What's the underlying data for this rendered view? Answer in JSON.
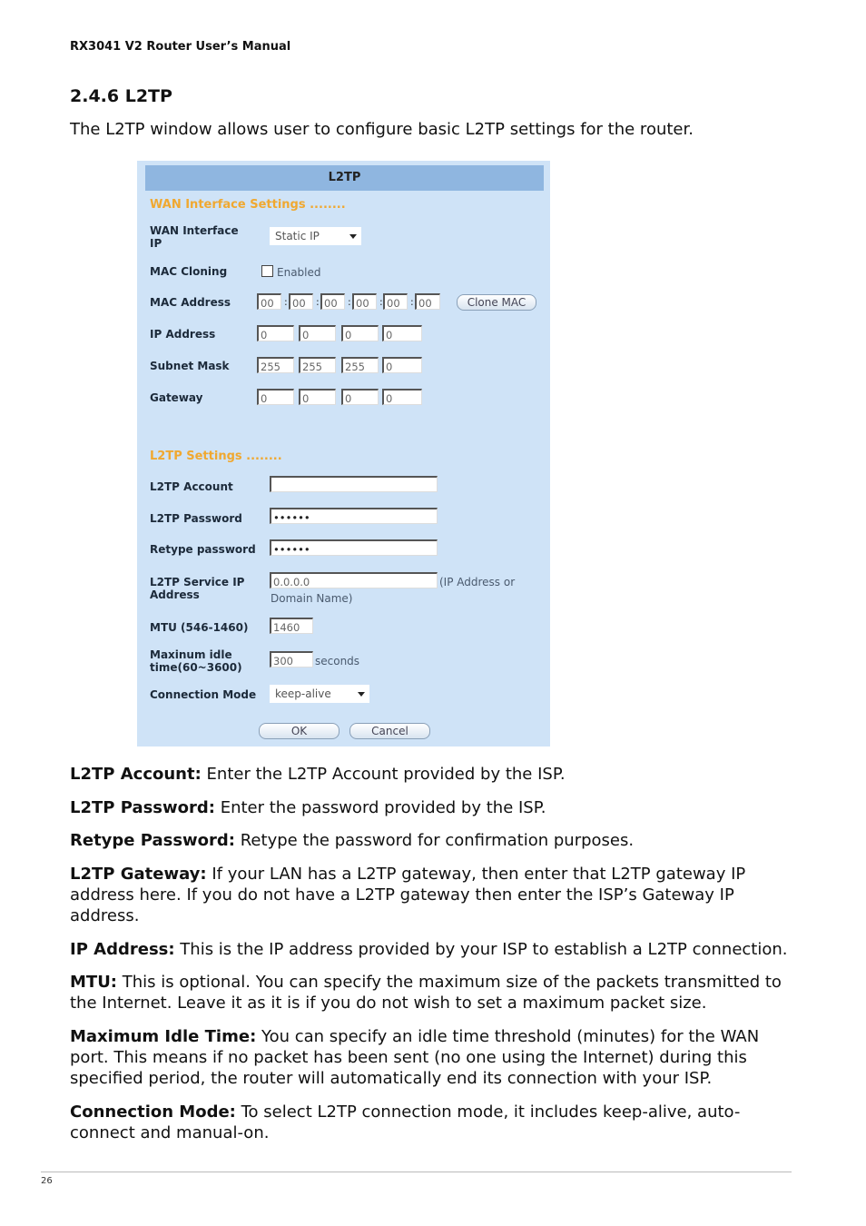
{
  "header": "RX3041 V2 Router User’s Manual",
  "section_title": "2.4.6 L2TP",
  "intro": "The L2TP window allows user to configure basic L2TP settings for the router.",
  "panel": {
    "title": "L2TP",
    "wan_group": "WAN Interface Settings ........",
    "wan_interface_label_1": "WAN Interface",
    "wan_interface_label_2": "IP",
    "wan_interface_value": "Static IP",
    "mac_cloning_label": "MAC Cloning",
    "mac_cloning_option": "Enabled",
    "mac_cloning_checked": false,
    "mac_address_label": "MAC Address",
    "mac": [
      "00",
      "00",
      "00",
      "00",
      "00",
      "00"
    ],
    "clone_mac": "Clone MAC",
    "ip_label": "IP Address",
    "ip": [
      "0",
      "0",
      "0",
      "0"
    ],
    "subnet_label": "Subnet Mask",
    "subnet": [
      "255",
      "255",
      "255",
      "0"
    ],
    "gateway_label": "Gateway",
    "gateway": [
      "0",
      "0",
      "0",
      "0"
    ],
    "l2tp_group": "L2TP Settings ........",
    "account_label": "L2TP Account",
    "account_value": "",
    "password_label": "L2TP Password",
    "password_value": "••••••",
    "retype_label": "Retype password",
    "retype_value": "••••••",
    "service_label_1": "L2TP Service IP",
    "service_label_2": "Address",
    "service_value": "0.0.0.0",
    "service_note_1": "(IP Address or",
    "service_note_2": "Domain Name)",
    "mtu_label": "MTU (546-1460)",
    "mtu_value": "1460",
    "idle_label_1": "Maxinum idle",
    "idle_label_2": "time(60~3600)",
    "idle_value": "300",
    "idle_unit": "seconds",
    "mode_label": "Connection Mode",
    "mode_value": "keep-alive",
    "ok": "OK",
    "cancel": "Cancel"
  },
  "descriptions": [
    {
      "term": "L2TP Account:",
      "text": " Enter the L2TP Account provided by the ISP."
    },
    {
      "term": "L2TP Password:",
      "text": " Enter the password provided by the ISP."
    },
    {
      "term": "Retype Password:",
      "text": " Retype the password for confirmation purposes."
    },
    {
      "term": "L2TP Gateway:",
      "text": " If your LAN has a L2TP gateway, then enter that L2TP gateway IP address here. If you do not have a L2TP gateway then enter the ISP’s Gateway IP address."
    },
    {
      "term": "IP Address:",
      "text": " This is the IP address provided by your ISP to establish a L2TP connection."
    },
    {
      "term": "MTU:",
      "text": " This is optional. You can specify the maximum size of the packets transmitted to the Internet. Leave it as it is if you do not wish to set a maximum packet size."
    },
    {
      "term": "Maximum Idle Time:",
      "text": " You can specify an idle time threshold (minutes) for the WAN port. This means if no packet has been sent (no one using the Internet) during this specified period, the router will automatically end its connection with your ISP."
    },
    {
      "term": "Connection Mode:",
      "text": " To select L2TP connection mode, it includes keep-alive, auto-connect and manual-on."
    }
  ],
  "page_number": "26"
}
